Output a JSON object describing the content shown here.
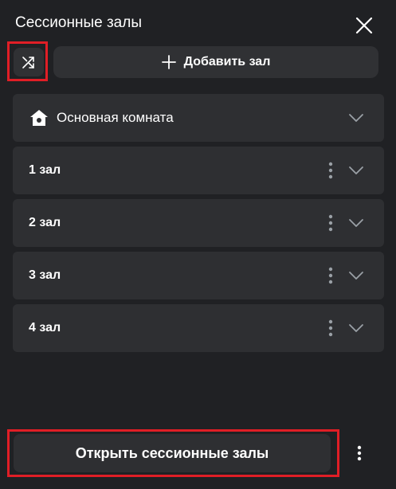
{
  "panel": {
    "title": "Сессионные залы"
  },
  "toolbar": {
    "shuffle_icon": "shuffle-icon",
    "add_label": "Добавить зал"
  },
  "rooms": {
    "main": {
      "label": "Основная комната",
      "icon": "home-icon"
    },
    "items": [
      {
        "label": "1 зал"
      },
      {
        "label": "2 зал"
      },
      {
        "label": "3 зал"
      },
      {
        "label": "4 зал"
      }
    ]
  },
  "footer": {
    "open_label": "Открыть сессионные залы"
  },
  "colors": {
    "background": "#202124",
    "card": "#2e2f32",
    "highlight": "#e01e26",
    "text": "#ffffff",
    "icon_muted": "#9aa0a6"
  }
}
